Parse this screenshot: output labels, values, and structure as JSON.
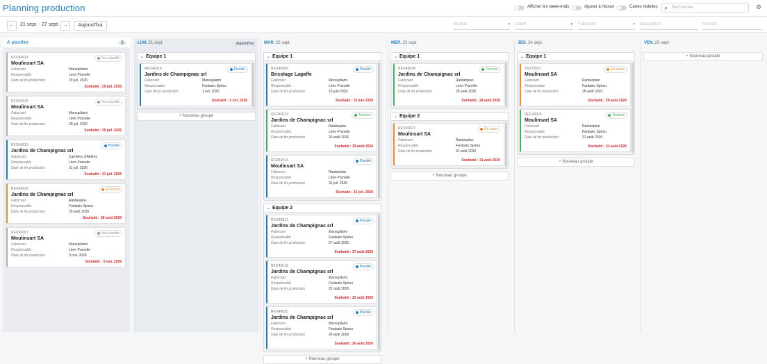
{
  "app_title": "Planning production",
  "toggles": {
    "weekends": "Afficher les week-ends",
    "fit": "Ajuster à l'écran",
    "reduced": "Cartes réduites"
  },
  "search_placeholder": "Rechercher",
  "nav": {
    "prev": "←",
    "next": "→",
    "range": "21 sept. - 27 sept.",
    "today_button": "Aujourd'hui"
  },
  "filters": {
    "journal": "Journal",
    "client": "Client",
    "fabricant": "Fabricant",
    "description": "Description",
    "numero": "Numéro"
  },
  "labels": {
    "fabricant": "Fabricant",
    "responsable": "Responsable",
    "date_fin": "Date de fin production",
    "new_group": "Nouveau groupe",
    "today_badge": "Aujourd'hui"
  },
  "icons": {
    "search": "magnifier-icon",
    "settings": "gear-icon",
    "collapse": "caret-down-icon",
    "add": "plus-icon"
  },
  "colors": {
    "accent": "#1d7fc1",
    "planned": "#1d7fc1",
    "done": "#41b35e",
    "progress": "#ee8a2c",
    "unplanned": "#999999",
    "wish": "#dd2222"
  },
  "backlog": {
    "title": "À planifier",
    "count": "5",
    "cards": [
      {
        "ref": "RF/240014",
        "name": "Moulinsart SA",
        "fab": "Marsupilami",
        "resp": "Léon Prunelle",
        "date": "29 juil. 2026",
        "status": "Non planifié",
        "sou": "Souhaité : 29 juil. 2026"
      },
      {
        "ref": "RF/240015",
        "name": "Moulinsart SA",
        "fab": "Marsupilami",
        "resp": "Léon Prunelle",
        "date": "30 juil. 2026",
        "status": "Non planifié",
        "sou": "Souhaité : 30 juil. 2026"
      },
      {
        "ref": "RF/240012",
        "name": "Jardins de Champignac srl",
        "fab": "Carrières d'Aldérix",
        "resp": "Léon Prunelle",
        "date": "31 juil. 2026",
        "status": "Planifié",
        "sou": "Souhaité : 31 juil. 2026"
      },
      {
        "ref": "RF/240025",
        "name": "Jardins de Champignac srl",
        "fab": "Rantanplan",
        "resp": "Fantasio Spirou",
        "date": "28 août 2026",
        "status": "En cours",
        "sou": "Souhaité : 28 août 2026"
      },
      {
        "ref": "RF/240007",
        "name": "Moulinsart SA",
        "fab": "Marsupilami",
        "resp": "Léon Prunelle",
        "date": "3 nov. 2026",
        "status": "Non planifié",
        "sou": "Souhaité : 3 nov. 2026"
      }
    ]
  },
  "days": [
    {
      "short": "LUN.",
      "num": "21 sept.",
      "groups": [
        {
          "name": "Equipe 1",
          "cards": [
            {
              "ref": "RF/240016",
              "name": "Jardins de Champignac srl",
              "fab": "Marsupilami",
              "resp": "Fantasio Spirou",
              "date": "1 oct. 2026",
              "status": "Planifié",
              "sou": "Souhaité : 1 oct. 2026"
            }
          ]
        }
      ]
    },
    {
      "short": "MAR.",
      "num": "22 sept.",
      "groups": [
        {
          "name": "Equipe 1",
          "cards": [
            {
              "ref": "RF/240006",
              "name": "Bricolage Lagaffe",
              "fab": "Marsupilami",
              "resp": "Léon Prunelle",
              "date": "15 juin 2026",
              "status": "Planifié",
              "sou": "Souhaité : 15 juin 2026"
            },
            {
              "ref": "RF/240023",
              "name": "Jardins de Champignac srl",
              "fab": "Rantanplan",
              "resp": "Léon Prunelle",
              "date": "26 août 2026",
              "status": "Terminé",
              "sou": "Souhaité : 29 août 2026"
            },
            {
              "ref": "RF/240013",
              "name": "Moulinsart SA",
              "fab": "Rantanplan",
              "resp": "Léon Prunelle",
              "date": "31 juil. 2026",
              "status": "Planifié",
              "sou": "Souhaité : 31 juil. 2026"
            }
          ]
        },
        {
          "name": "Equipe 2",
          "cards": [
            {
              "ref": "RF/240017",
              "name": "Jardins de Champignac srl",
              "fab": "Marsupilami",
              "resp": "Fantasio Spirou",
              "date": "27 août 2026",
              "status": "Planifié",
              "sou": "Souhaité : 27 août 2026"
            },
            {
              "ref": "RF/240019",
              "name": "Jardins de Champignac srl",
              "fab": "Marsupilami",
              "resp": "Fantasio Spirou",
              "date": "22 août 2026",
              "status": "Planifié",
              "sou": "Souhaité : 22 août 2026"
            },
            {
              "ref": "RF/240020",
              "name": "Jardins de Champignac srl",
              "fab": "Marsupilami",
              "resp": "Fantasio Spirou",
              "date": "26 août 2026",
              "status": "Planifié",
              "sou": "Souhaité : 26 août 2026"
            }
          ]
        }
      ]
    },
    {
      "short": "MER.",
      "num": "23 sept.",
      "groups": [
        {
          "name": "Equipe 1",
          "cards": [
            {
              "ref": "RF/240024",
              "name": "Jardins de Champignac srl",
              "fab": "Rantanplan",
              "resp": "Léon Prunelle",
              "date": "28 août 2026",
              "status": "Terminé",
              "sou": "Souhaité : 28 août 2026"
            }
          ]
        },
        {
          "name": "Equipe 2",
          "cards": [
            {
              "ref": "RF/240027",
              "name": "Moulinsart SA",
              "fab": "Rantanplan",
              "resp": "Fantasio Spirou",
              "date": "31 août 2026",
              "status": "En cours",
              "sou": "Souhaité : 31 août 2026"
            }
          ]
        }
      ]
    },
    {
      "short": "JEU.",
      "num": "24 sept.",
      "groups": [
        {
          "name": "Equipe 1",
          "cards": [
            {
              "ref": "TEST0002",
              "name": "Moulinsart SA",
              "fab": "Rantanplan",
              "resp": "Fantasio Spirou",
              "date": "28 août 2026",
              "status": "En cours",
              "sou": "Souhaité : 29 août 2026"
            },
            {
              "ref": "RF/240026",
              "name": "Moulinsart SA",
              "fab": "Rantanplan",
              "resp": "Fantasio Spirou",
              "date": "31 août 2026",
              "status": "Terminé",
              "sou": "Souhaité : 31 août 2026"
            }
          ]
        }
      ]
    },
    {
      "short": "VEN.",
      "num": "25 sept.",
      "groups": []
    }
  ]
}
